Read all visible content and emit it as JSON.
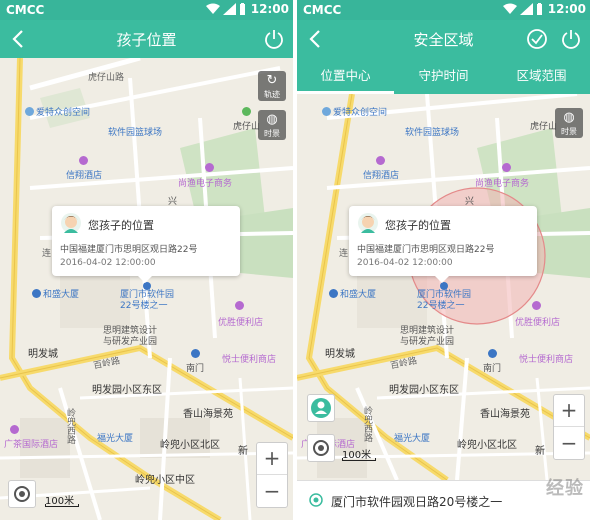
{
  "status": {
    "carrier": "CMCC",
    "time": "12:00"
  },
  "left": {
    "title": "孩子位置",
    "map_labels": {
      "hutoushan_road": "虎仔山路",
      "aite": "爱特众创空间",
      "basketball": "软件园篮球场",
      "huzaishan": "虎仔山",
      "xinyang_hotel": "信翔酒店",
      "shangyu": "尚渔电子商务",
      "xing": "兴",
      "hesheng": "和盛大厦",
      "softpark": "厦门市软件园22号楼之一",
      "youjian": "优胜便利店",
      "design": "思明建筑设计与研发产业园",
      "mingfa": "明发城",
      "bailing_road": "百岭路",
      "nanmen": "南门",
      "yuesheng": "悦士便利商店",
      "mingfayuan_east": "明发园小区东区",
      "lingdou_west": "岭兜西路",
      "xiangshan": "香山海景苑",
      "guangcai_hotel": "广茶国际酒店",
      "fuguang": "福光大厦",
      "lingdou_north": "岭兜小区北区",
      "lingdou_mid": "岭兜小区中区",
      "xin": "新",
      "lian": "连"
    },
    "buttons": {
      "track_label": "轨迹",
      "time_label": "时景"
    },
    "popup": {
      "title": "您孩子的位置",
      "address": "中国福建厦门市思明区观日路22号",
      "time": "2016-04-02 12:00:00"
    },
    "scale": "100米"
  },
  "right": {
    "title": "安全区域",
    "tabs": [
      "位置中心",
      "守护时间",
      "区域范围"
    ],
    "map_labels": {
      "aite": "爱特众创空间",
      "basketball": "软件园篮球场",
      "huzaishan": "虎仔山",
      "xinyang_hotel": "信翔酒店",
      "shangyu": "尚渔电子商务",
      "xing": "兴",
      "hesheng": "和盛大厦",
      "softpark": "厦门市软件园22号楼之一",
      "youjian": "优胜便利店",
      "design": "思明建筑设计与研发产业园",
      "mingfa": "明发城",
      "bailing_road": "百岭路",
      "nanmen": "南门",
      "yuesheng": "悦士便利商店",
      "mingfayuan_east": "明发园小区东区",
      "lingdou_west": "岭兜西路",
      "xiangshan": "香山海景苑",
      "guangcai_hotel": "广茶国际酒店",
      "fuguang": "福光大厦",
      "lingdou_north": "岭兜小区北区",
      "xin": "新",
      "lian": "连"
    },
    "buttons": {
      "time_label": "时景"
    },
    "popup": {
      "title": "您孩子的位置",
      "address": "中国福建厦门市思明区观日路22号",
      "time": "2016-04-02 12:00:00"
    },
    "scale": "100米",
    "address_bar": "厦门市软件园观日路20号楼之一",
    "watermark": "经验"
  },
  "colors": {
    "header": "#3bbc9f",
    "statusbar": "#38b59a",
    "zone": "#f3b4b4"
  }
}
